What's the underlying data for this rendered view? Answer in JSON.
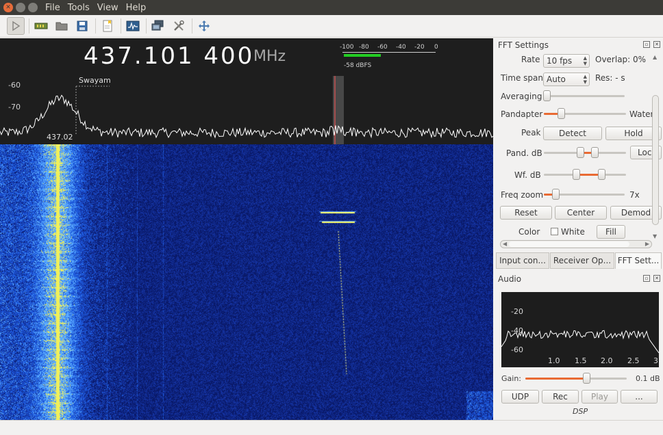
{
  "menu": {
    "items": [
      "File",
      "Tools",
      "View",
      "Help"
    ]
  },
  "toolbar": {
    "buttons": [
      "play-icon",
      "sdr-device-icon",
      "open-folder-icon",
      "save-icon",
      "bookmark-icon",
      "fft-display-icon",
      "network-icon",
      "tools-icon",
      "fit-view-icon"
    ]
  },
  "receiver": {
    "frequency": "437.101 400",
    "unit": "MHz"
  },
  "meter": {
    "ticks": [
      "-100",
      "-80",
      "-60",
      "-40",
      "-20",
      "0"
    ],
    "level_text": "-58 dBFS",
    "level_fraction": 0.4
  },
  "pandapter": {
    "y_labels": [
      "-60",
      "-70"
    ],
    "bookmark_label": "Swayam",
    "freq_label": "437.02"
  },
  "fft_settings": {
    "title": "FFT Settings",
    "rate_label": "Rate",
    "rate_value": "10 fps",
    "overlap_label": "Overlap: 0%",
    "timespan_label": "Time span",
    "timespan_value": "Auto",
    "res_label": "Res: - s",
    "averaging_label": "Averaging",
    "pandapter_label": "Pandapter",
    "waterfall_label": "Water",
    "peak_label": "Peak",
    "detect_label": "Detect",
    "hold_label": "Hold",
    "pand_db_label": "Pand. dB",
    "lock_label": "Loc",
    "wf_db_label": "Wf. dB",
    "freq_zoom_label": "Freq zoom",
    "freq_zoom_value": "7x",
    "reset_label": "Reset",
    "center_label": "Center",
    "demod_label": "Demod",
    "color_label": "Color",
    "white_label": "White",
    "fill_label": "Fill"
  },
  "tabs": [
    "Input con...",
    "Receiver Op...",
    "FFT Sett..."
  ],
  "audio": {
    "title": "Audio",
    "y_labels": [
      "-20",
      "-40",
      "-60"
    ],
    "x_labels": [
      "1.0",
      "1.5",
      "2.0",
      "2.5",
      "3"
    ],
    "gain_label": "Gain:",
    "gain_value": "0.1 dB",
    "udp_label": "UDP",
    "rec_label": "Rec",
    "play_label": "Play",
    "more_label": "...",
    "dsp_label": "DSP"
  },
  "colors": {
    "waterfall_bg": "#0a1a6a",
    "signal_yellow": "#ffff66",
    "accent_orange": "#e96a33",
    "meter_green": "#22cc22"
  }
}
